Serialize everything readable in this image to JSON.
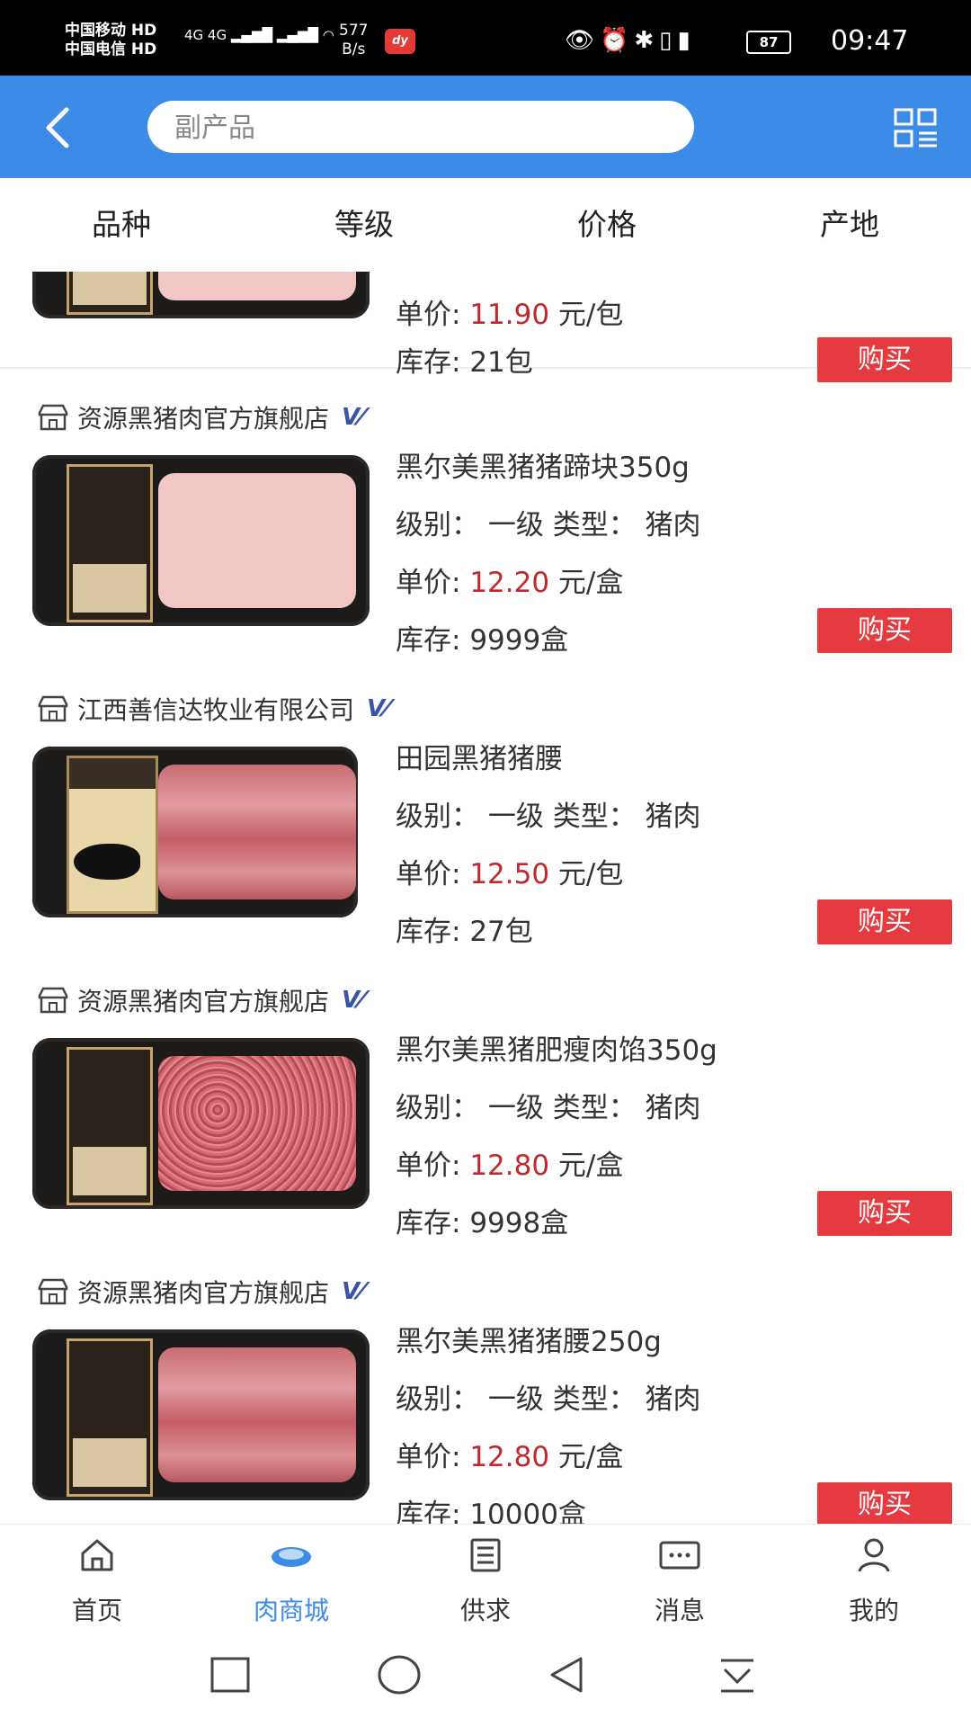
{
  "status_bar": {
    "carrier1": "中国移动",
    "carrier1_hd": "HD",
    "carrier2": "中国电信",
    "carrier2_hd": "HD",
    "network": "4G 4G",
    "speed_value": "577",
    "speed_unit": "B/s",
    "battery": "87",
    "time": "09:47"
  },
  "header": {
    "search_value": "",
    "search_placeholder": "副产品"
  },
  "filters": [
    "品种",
    "等级",
    "价格",
    "产地"
  ],
  "products": [
    {
      "store": "",
      "name": "",
      "grade": "",
      "price_label": "单价:",
      "price": "11.90",
      "unit": "元/包",
      "stock_label": "库存:",
      "stock": "21包",
      "buy": "购买"
    },
    {
      "store": "资源黑猪肉官方旗舰店",
      "name": "黑尔美黑猪猪蹄块350g",
      "grade": "级别： 一级 类型： 猪肉",
      "price_label": "单价:",
      "price": "12.20",
      "unit": "元/盒",
      "stock_label": "库存:",
      "stock": "9999盒",
      "buy": "购买"
    },
    {
      "store": "江西善信达牧业有限公司",
      "name": "田园黑猪猪腰",
      "grade": "级别： 一级 类型： 猪肉",
      "price_label": "单价:",
      "price": "12.50",
      "unit": "元/包",
      "stock_label": "库存:",
      "stock": "27包",
      "buy": "购买"
    },
    {
      "store": "资源黑猪肉官方旗舰店",
      "name": "黑尔美黑猪肥瘦肉馅350g",
      "grade": "级别： 一级 类型： 猪肉",
      "price_label": "单价:",
      "price": "12.80",
      "unit": "元/盒",
      "stock_label": "库存:",
      "stock": "9998盒",
      "buy": "购买"
    },
    {
      "store": "资源黑猪肉官方旗舰店",
      "name": "黑尔美黑猪猪腰250g",
      "grade": "级别： 一级 类型： 猪肉",
      "price_label": "单价:",
      "price": "12.80",
      "unit": "元/盒",
      "stock_label": "库存:",
      "stock": "10000盒",
      "buy": "购买"
    }
  ],
  "bottom_nav": [
    {
      "label": "首页",
      "icon": "home-icon",
      "active": false
    },
    {
      "label": "肉商城",
      "icon": "meat-mall-icon",
      "active": true
    },
    {
      "label": "供求",
      "icon": "list-icon",
      "active": false
    },
    {
      "label": "消息",
      "icon": "message-icon",
      "active": false
    },
    {
      "label": "我的",
      "icon": "user-icon",
      "active": false
    }
  ],
  "colors": {
    "header": "#3c8be6",
    "price": "#c0282d",
    "buy_button": "#e53a40",
    "active_nav": "#3c8be6"
  }
}
